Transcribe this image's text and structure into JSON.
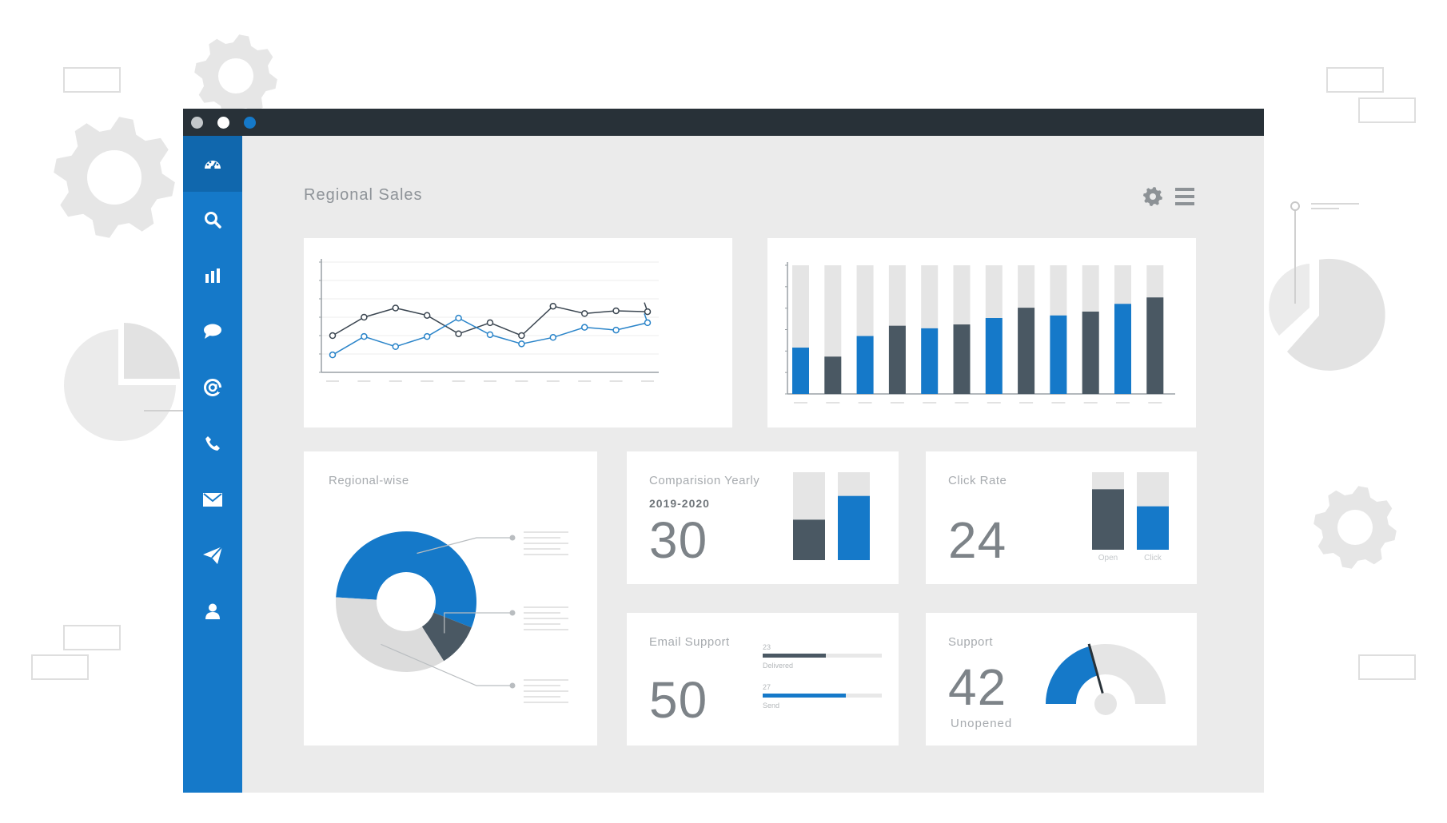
{
  "page": {
    "title": "Regional Sales",
    "colors": {
      "accent": "#1579c9",
      "dark": "#4a5863",
      "light": "#e3e3e3",
      "titlebar": "#283138"
    }
  },
  "window_controls": [
    {
      "name": "close-dot",
      "color": "#c4c8cb"
    },
    {
      "name": "minimize-dot",
      "color": "#ffffff"
    },
    {
      "name": "maximize-dot",
      "color": "#1579c9"
    }
  ],
  "sidebar": {
    "items": [
      {
        "icon": "dashboard-icon",
        "active": true
      },
      {
        "icon": "search-icon"
      },
      {
        "icon": "bar-chart-icon"
      },
      {
        "icon": "chat-icon"
      },
      {
        "icon": "at-sign-icon"
      },
      {
        "icon": "phone-icon"
      },
      {
        "icon": "mail-icon"
      },
      {
        "icon": "send-icon"
      },
      {
        "icon": "user-icon"
      }
    ]
  },
  "header_icons": [
    "gear-icon",
    "menu-icon"
  ],
  "line_chart": {
    "chart_data": {
      "type": "line",
      "x": [
        1,
        2,
        3,
        4,
        5,
        6,
        7,
        8,
        9,
        10,
        11
      ],
      "ylim": [
        0,
        6
      ],
      "grid": true,
      "series": [
        {
          "color": "#3a4550",
          "values": [
            2.0,
            3.0,
            3.5,
            3.1,
            2.1,
            2.7,
            2.0,
            3.6,
            3.2,
            3.35,
            3.3
          ]
        },
        {
          "color": "#2a84c9",
          "values": [
            0.95,
            1.95,
            1.4,
            1.95,
            2.95,
            2.05,
            1.55,
            1.9,
            2.45,
            2.3,
            2.7
          ]
        }
      ]
    }
  },
  "bar_chart": {
    "chart_data": {
      "type": "bar",
      "categories": [
        "",
        "",
        "",
        "",
        "",
        "",
        "",
        "",
        "",
        "",
        "",
        ""
      ],
      "ylim": [
        0,
        100
      ],
      "values": [
        36,
        29,
        45,
        53,
        51,
        54,
        59,
        67,
        61,
        64,
        70,
        75
      ],
      "colors": [
        "blue",
        "dark",
        "blue",
        "dark",
        "blue",
        "dark",
        "blue",
        "dark",
        "blue",
        "dark",
        "blue",
        "dark"
      ]
    }
  },
  "regional": {
    "title": "Regional-wise",
    "chart_data": {
      "type": "pie",
      "values": [
        55,
        10,
        35
      ],
      "colors": [
        "#1579c9",
        "#4a5863",
        "#dcdcdc"
      ]
    }
  },
  "comparison": {
    "title": "Comparision Yearly",
    "period": "2019-2020",
    "value": "30",
    "chart_data": {
      "type": "bar",
      "ylim": [
        0,
        100
      ],
      "values": [
        46,
        73
      ],
      "colors": [
        "#4a5863",
        "#1579c9"
      ]
    }
  },
  "click_rate": {
    "title": "Click Rate",
    "value": "24",
    "chart_data": {
      "type": "bar",
      "categories": [
        "Open",
        "Click"
      ],
      "ylim": [
        0,
        100
      ],
      "values": [
        78,
        56
      ],
      "colors": [
        "#4a5863",
        "#1579c9"
      ]
    }
  },
  "email_support": {
    "title": "Email Support",
    "value": "50",
    "bars": [
      {
        "count": "23",
        "label": "Delivered",
        "fraction": 0.53,
        "color": "#4a5863"
      },
      {
        "count": "27",
        "label": "Send",
        "fraction": 0.7,
        "color": "#1579c9"
      }
    ]
  },
  "support": {
    "title": "Support",
    "value": "42",
    "label": "Unopened",
    "gauge": {
      "fraction": 0.42,
      "color": "#1579c9"
    }
  }
}
